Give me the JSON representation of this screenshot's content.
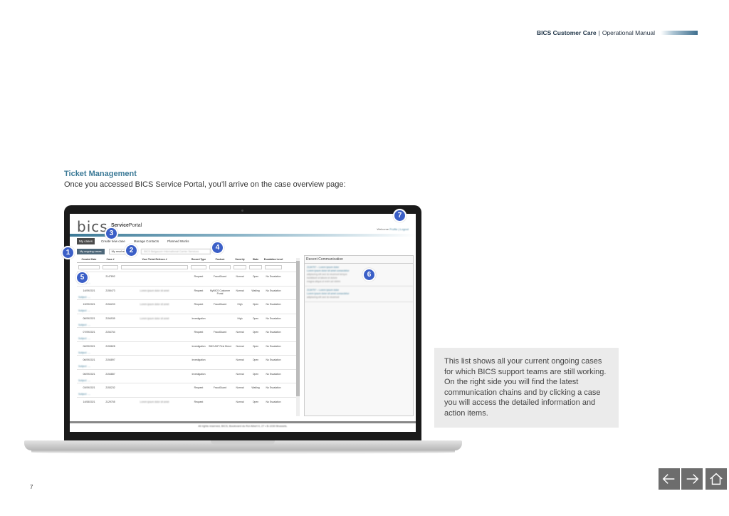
{
  "header": {
    "brand": "BICS Customer Care",
    "separator": "|",
    "doc": "Operational Manual"
  },
  "section": {
    "title": "Ticket Management",
    "intro": "Once you accessed BICS Service Portal, you’ll arrive on the case overview page:"
  },
  "portal": {
    "logo": "bics",
    "service": "Service",
    "portal": "Portal",
    "welcome_prefix": "Welcome",
    "welcome_links": "Profile | Logout",
    "nav": [
      "My cases",
      "Create new case",
      "Manage Contacts",
      "Planned Works"
    ],
    "subnav": {
      "ongoing": "My ongoing cases",
      "resolved": "My resolved cases",
      "select": "BICS Belgacom International Carrier Services"
    },
    "columns": [
      "Created Date",
      "Case #",
      "Your Ticket Refence #",
      "Record Type",
      "Product",
      "Severity",
      "State",
      "Escalation Level"
    ],
    "rows": [
      {
        "date": "",
        "case": "2147892",
        "ref": "",
        "type": "Request",
        "product": "FraudGuard",
        "sev": "Normal",
        "state": "Open",
        "esc": "No Escalation",
        "sub": "Subject: ...."
      },
      {
        "date": "14/09/2021",
        "case": "2155473",
        "ref": "Lorem ipsum dolor sit amet",
        "type": "Request",
        "product": "MyBICS Customer Portal",
        "sev": "Normal",
        "state": "Waiting",
        "esc": "No Escalation",
        "sub": "Subject: ...."
      },
      {
        "date": "13/09/2021",
        "case": "2154203",
        "ref": "Lorem ipsum dolor sit amet",
        "type": "Request",
        "product": "FraudGuard",
        "sev": "High",
        "state": "Open",
        "esc": "No Escalation",
        "sub": "Subject: ...."
      },
      {
        "date": "08/09/2021",
        "case": "2154939",
        "ref": "Lorem ipsum dolor sit amet",
        "type": "Investigation",
        "product": "",
        "sev": "High",
        "state": "Open",
        "esc": "No Escalation",
        "sub": "Subject: ...."
      },
      {
        "date": "07/09/2021",
        "case": "2154754",
        "ref": "",
        "type": "Request",
        "product": "FraudGuard",
        "sev": "Normal",
        "state": "Open",
        "esc": "No Escalation",
        "sub": "Subject: ...."
      },
      {
        "date": "06/09/2021",
        "case": "2153828",
        "ref": "",
        "type": "Investigation",
        "product": "SMS A2P First Direct",
        "sev": "Normal",
        "state": "Open",
        "esc": "No Escalation",
        "sub": "Subject: ...."
      },
      {
        "date": "06/09/2021",
        "case": "2154897",
        "ref": "",
        "type": "Investigation",
        "product": "",
        "sev": "Normal",
        "state": "Open",
        "esc": "No Escalation",
        "sub": "Subject: ...."
      },
      {
        "date": "06/09/2021",
        "case": "2154887",
        "ref": "",
        "type": "Investigation",
        "product": "",
        "sev": "Normal",
        "state": "Open",
        "esc": "No Escalation",
        "sub": "Subject: ...."
      },
      {
        "date": "03/09/2021",
        "case": "2153232",
        "ref": "",
        "type": "Request",
        "product": "FraudGuard",
        "sev": "Normal",
        "state": "Waiting",
        "esc": "No Escalation",
        "sub": "Subject: ...."
      },
      {
        "date": "14/08/2021",
        "case": "2129755",
        "ref": "Lorem ipsum dolor sit amet",
        "type": "Request",
        "product": "",
        "sev": "Normal",
        "state": "Open",
        "esc": "No Escalation",
        "sub": ""
      }
    ],
    "recent": {
      "title": "Recent Communication",
      "items": [
        {
          "head": "2134797 – Lorem ipsum dolor",
          "lines": [
            "Lorem ipsum dolor sit amet consectetur",
            "adipiscing elit sed do eiusmod tempor",
            "incididunt ut labore et dolore",
            "magna aliqua ut enim ad minim"
          ]
        },
        {
          "head": "2134797 – Lorem ipsum dolor",
          "lines": [
            "Lorem ipsum dolor sit amet consectetur",
            "adipiscing elit sed do eiusmod"
          ]
        }
      ]
    },
    "footer": "All rights reserved, BICS, Boulevard du Roi Albert II, 27 • B-1030 Brussels."
  },
  "badges": [
    "1",
    "2",
    "3",
    "4",
    "5",
    "6",
    "7"
  ],
  "note": "This list shows all your current ongoing cases for which BICS support teams are still working. On the right side you will find the latest communication chains and by clicking a case you will access the detailed information and action items.",
  "page_number": "7",
  "icons": [
    "arrow-left-icon",
    "arrow-right-icon",
    "home-icon"
  ]
}
